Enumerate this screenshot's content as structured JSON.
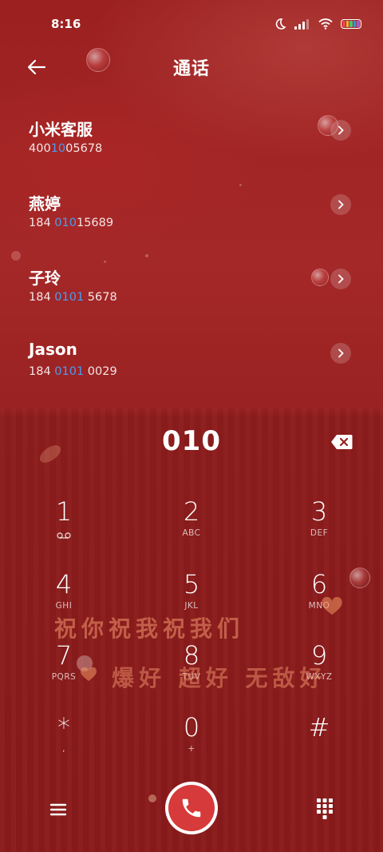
{
  "status_bar": {
    "time": "8:16"
  },
  "header": {
    "title": "通话"
  },
  "contacts": [
    {
      "name": "小米客服",
      "number_pre": "400",
      "number_match": "10",
      "number_post": "05678"
    },
    {
      "name": "燕婷",
      "number_pre": "184 ",
      "number_match": "010",
      "number_post": "15689"
    },
    {
      "name": "子玲",
      "number_pre": "184 ",
      "number_match": "0101",
      "number_post": " 5678"
    },
    {
      "name": "Jason",
      "number_pre": "184 ",
      "number_match": "0101",
      "number_post": " 0029"
    }
  ],
  "dialer": {
    "input": "010",
    "keys": [
      {
        "digit": "1",
        "sub": ""
      },
      {
        "digit": "2",
        "sub": "ABC"
      },
      {
        "digit": "3",
        "sub": "DEF"
      },
      {
        "digit": "4",
        "sub": "GHI"
      },
      {
        "digit": "5",
        "sub": "JKL"
      },
      {
        "digit": "6",
        "sub": "MNO"
      },
      {
        "digit": "7",
        "sub": "PQRS"
      },
      {
        "digit": "8",
        "sub": "TUV"
      },
      {
        "digit": "9",
        "sub": "WXYZ"
      },
      {
        "digit": "*",
        "sub": ","
      },
      {
        "digit": "0",
        "sub": "+"
      },
      {
        "digit": "#",
        "sub": ""
      }
    ]
  },
  "banner": {
    "line1": "祝你祝我祝我们",
    "line2": "爆好 超好 无敌好"
  },
  "colors": {
    "match_highlight": "#4a9cf2",
    "call_button": "#d63a3a",
    "background": "#9f2222"
  }
}
